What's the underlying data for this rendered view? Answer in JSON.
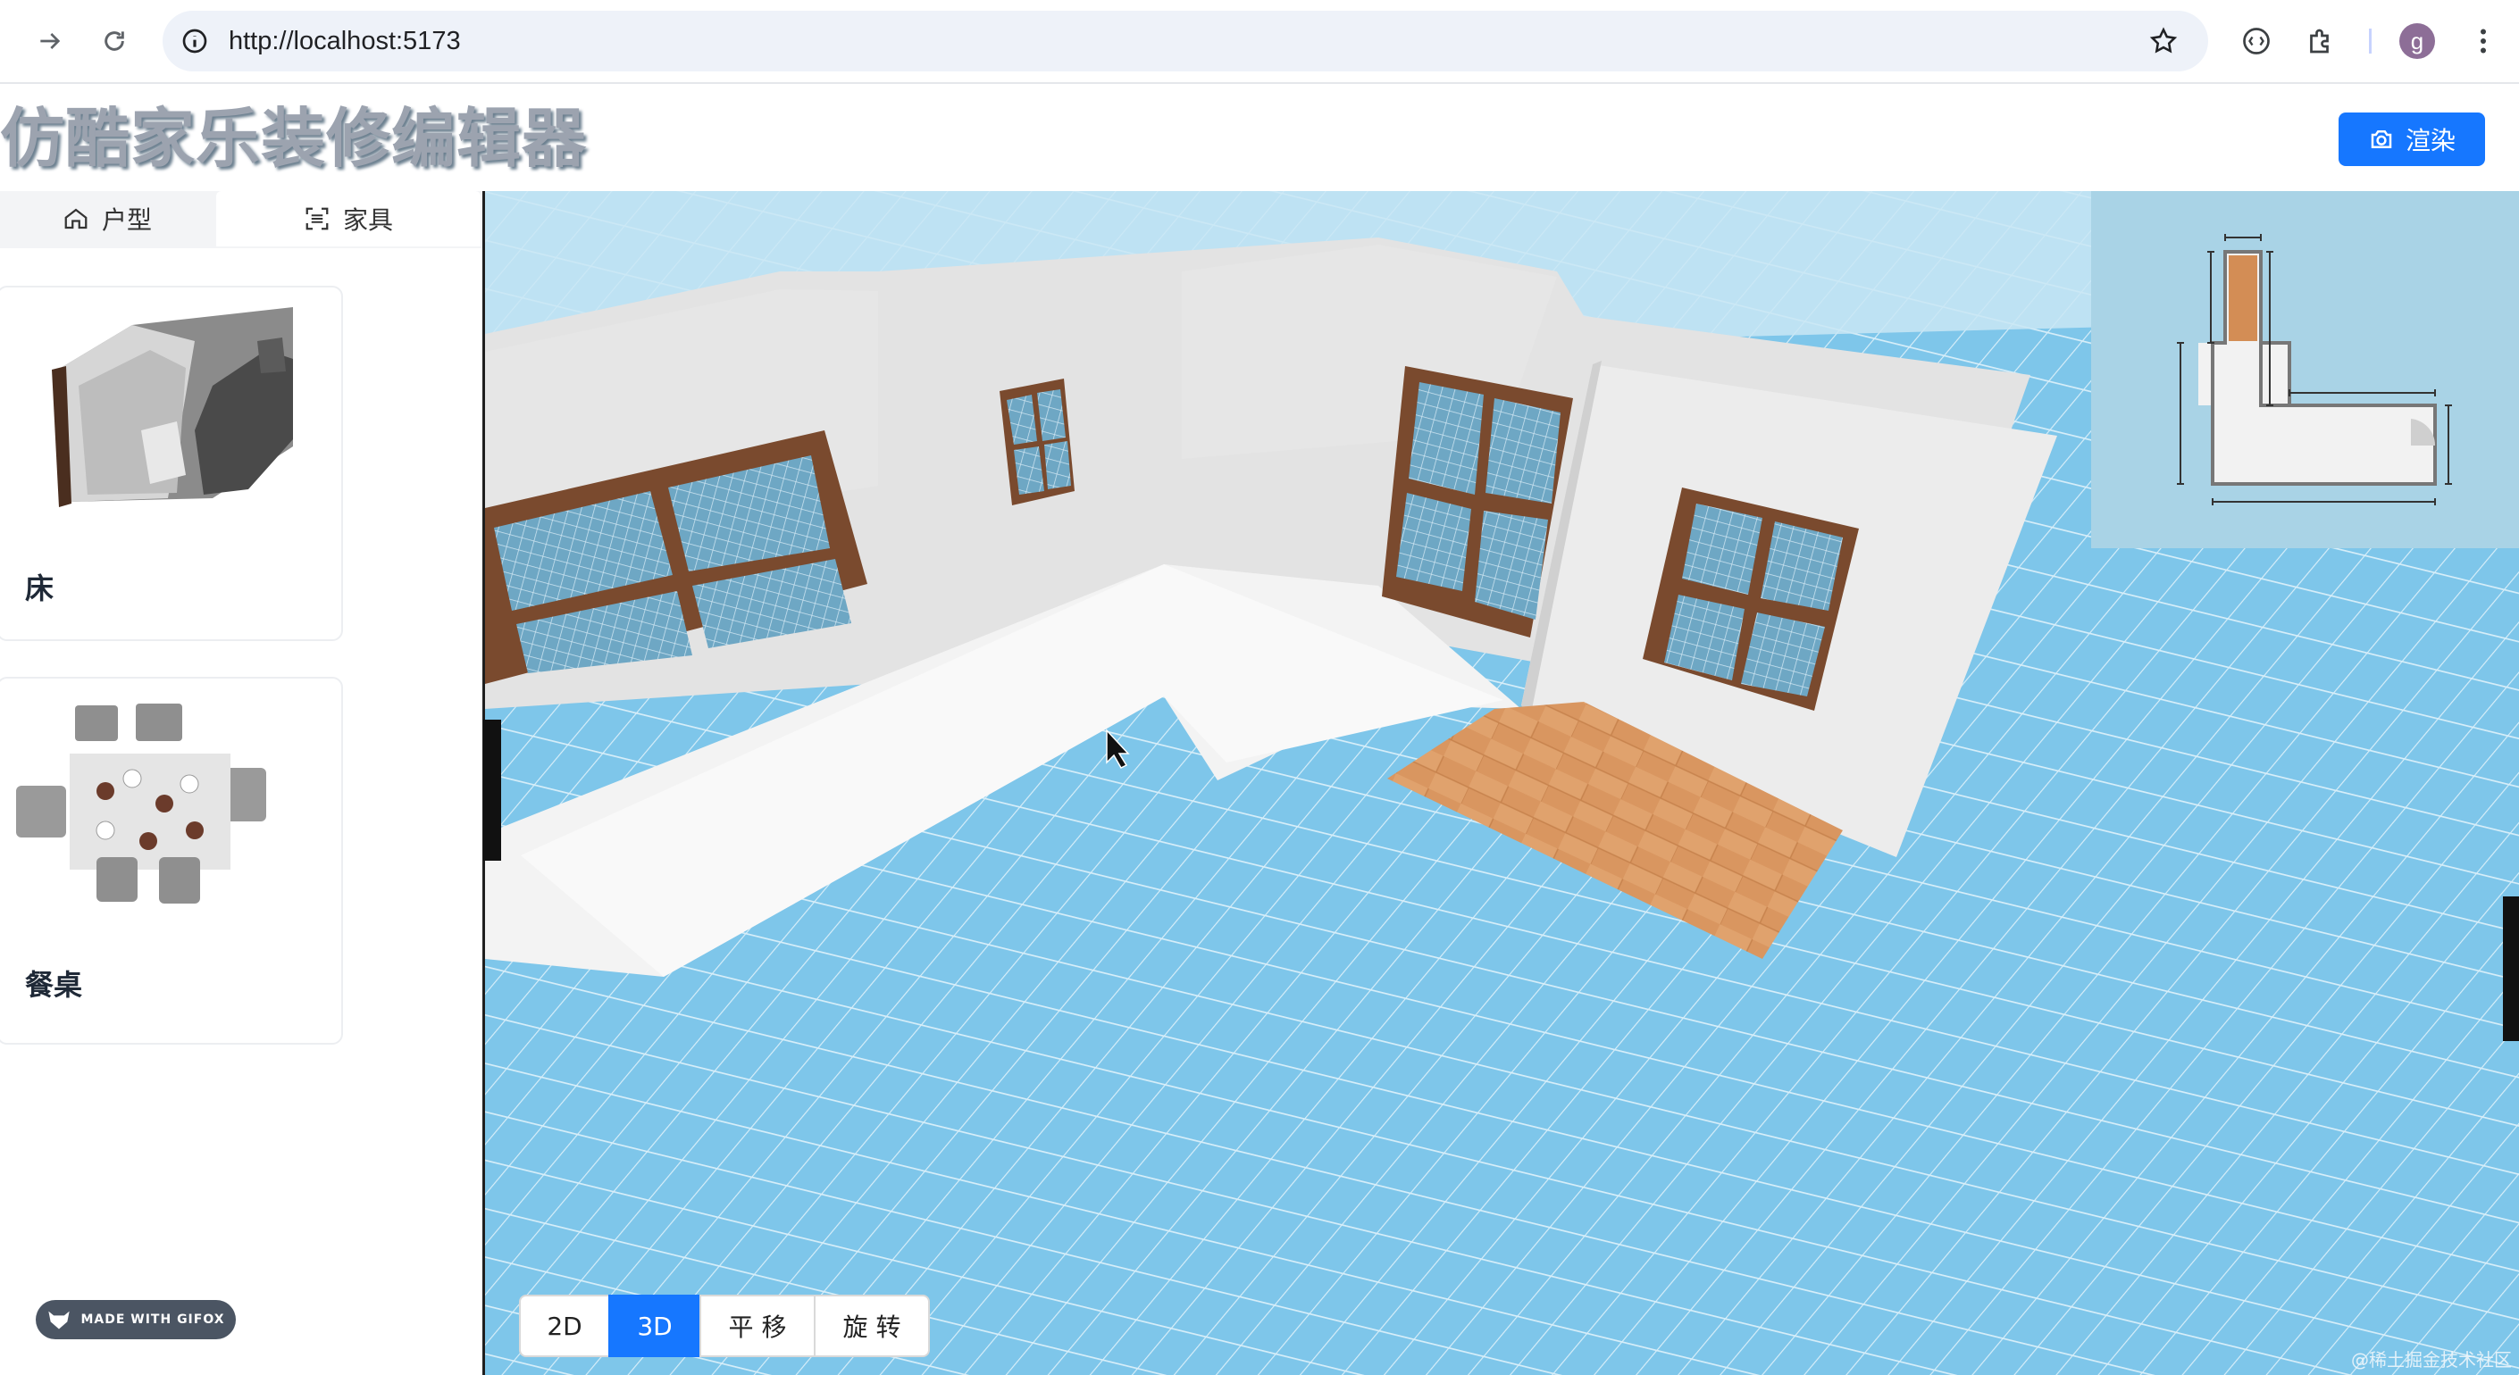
{
  "browser": {
    "url": "http://localhost:5173",
    "profile_initial": "g",
    "icons": [
      "forward-icon",
      "reload-icon",
      "info-icon",
      "star-icon",
      "media-icon",
      "extensions-icon",
      "menu-icon"
    ]
  },
  "app": {
    "title": "仿酷家乐装修编辑器",
    "render_button": "渲染",
    "accent_color": "#1677ff"
  },
  "sidebar": {
    "tabs": [
      {
        "label": "户型",
        "icon": "home-icon",
        "active": false
      },
      {
        "label": "家具",
        "icon": "scan-icon",
        "active": true
      }
    ],
    "furniture": [
      {
        "label": "床",
        "icon": "bed-thumbnail"
      },
      {
        "label": "餐桌",
        "icon": "dining-table-thumbnail"
      }
    ]
  },
  "viewport": {
    "mode_buttons": [
      {
        "label": "2D",
        "active": false
      },
      {
        "label": "3D",
        "active": true
      },
      {
        "label": "平 移",
        "active": false
      },
      {
        "label": "旋 转",
        "active": false
      }
    ],
    "watermark": "@稀土掘金技术社区"
  },
  "overlay": {
    "gifox_badge": "MADE WITH GIFOX"
  }
}
